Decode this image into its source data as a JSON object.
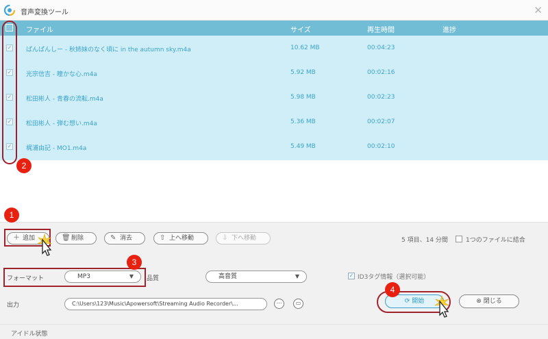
{
  "window": {
    "title": "音声変換ツール"
  },
  "file_list": {
    "columns": {
      "file": "ファイル",
      "size": "サイズ",
      "duration": "再生時間",
      "progress": "進捗"
    },
    "rows": [
      {
        "name": "ぱんぱんしー - 秋姉妹のなく頃に in the autumn sky.m4a",
        "size": "10.62 MB",
        "duration": "00:04:23",
        "checked": true
      },
      {
        "name": "光宗信吉 - 瞳かな心.m4a",
        "size": "5.92 MB",
        "duration": "00:02:16",
        "checked": true
      },
      {
        "name": "松田彬人 - 青春の流転.m4a",
        "size": "5.98 MB",
        "duration": "00:02:23",
        "checked": true
      },
      {
        "name": "松田彬人 - 弾む想い.m4a",
        "size": "5.36 MB",
        "duration": "00:02:07",
        "checked": true
      },
      {
        "name": "梶浦由記 - MO1.m4a",
        "size": "5.49 MB",
        "duration": "00:02:10",
        "checked": true
      }
    ]
  },
  "toolbar": {
    "add": "追加",
    "delete": "削除",
    "clear": "消去",
    "move_up": "上へ移動",
    "move_down": "下へ移動",
    "summary": "5 項目、14 分間",
    "merge_label": "1つのファイルに結合"
  },
  "settings": {
    "format_label": "フォーマット",
    "format_value": "MP3",
    "quality_label": "品質",
    "quality_value": "高音質",
    "id3_label": "ID3タグ情報（選択可能）",
    "output_label": "出力",
    "output_path": "C:\\Users\\123\\Music\\Apowersoft\\Streaming Audio Recorder\\..."
  },
  "actions": {
    "start": "開始",
    "close": "閉じる"
  },
  "status": {
    "text": "アイドル状態"
  },
  "annotations": {
    "badge1": "1",
    "badge2": "2",
    "badge3": "3",
    "badge4": "4"
  },
  "colors": {
    "header": "#72bdd6",
    "row_bg": "#d0eef8",
    "annotation": "#e8200f",
    "accent": "#2d9ccd"
  }
}
